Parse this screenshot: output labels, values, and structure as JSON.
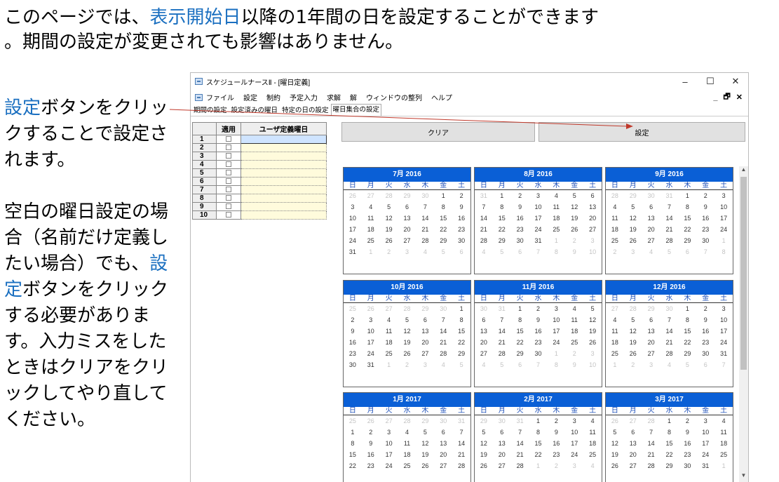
{
  "headline": {
    "part1": "このページでは、",
    "link": "表示開始日",
    "part2": "以降の1年間の日を設定することができます",
    "line2": "。期間の設定が変更されても影響はありません。"
  },
  "side": {
    "p1_link": "設定",
    "p1_text": "ボタンをクリックすることで設定されます。",
    "p2_text1": "空白の曜日設定の場合（名前だけ定義したい場合）でも、",
    "p2_link": "設定",
    "p2_text2": "ボタンをクリックする必要があります。入力ミスをしたときはクリアをクリックしてやり直してください。"
  },
  "window": {
    "title": "スケジュールナースⅡ - [曜日定義]",
    "min": "–",
    "max": "☐",
    "close": "✕",
    "mdi_min": "_",
    "mdi_restore": "🗗",
    "mdi_close": "✕"
  },
  "menu": [
    "ファイル",
    "設定",
    "制約",
    "予定入力",
    "求解",
    "解",
    "ウィンドウの整列",
    "ヘルプ"
  ],
  "tabs": [
    "期間の設定",
    "設定済みの曜日",
    "特定の日の設定",
    "曜日集合の設定"
  ],
  "grid": {
    "col_apply": "適用",
    "col_name": "ユーザ定義曜日",
    "rows": [
      "1",
      "2",
      "3",
      "4",
      "5",
      "6",
      "7",
      "8",
      "9",
      "10"
    ]
  },
  "buttons": {
    "clear": "クリア",
    "set": "設定"
  },
  "weekdays": [
    "日",
    "月",
    "火",
    "水",
    "木",
    "金",
    "土"
  ],
  "calendars": [
    {
      "title": "7月 2016",
      "days": [
        "26",
        "27",
        "28",
        "29",
        "30",
        "1",
        "2",
        "3",
        "4",
        "5",
        "6",
        "7",
        "8",
        "9",
        "10",
        "11",
        "12",
        "13",
        "14",
        "15",
        "16",
        "17",
        "18",
        "19",
        "20",
        "21",
        "22",
        "23",
        "24",
        "25",
        "26",
        "27",
        "28",
        "29",
        "30",
        "31",
        "1",
        "2",
        "3",
        "4",
        "5",
        "6"
      ],
      "lead": 5,
      "count": 31
    },
    {
      "title": "8月 2016",
      "days": [
        "31",
        "1",
        "2",
        "3",
        "4",
        "5",
        "6",
        "7",
        "8",
        "9",
        "10",
        "11",
        "12",
        "13",
        "14",
        "15",
        "16",
        "17",
        "18",
        "19",
        "20",
        "21",
        "22",
        "23",
        "24",
        "25",
        "26",
        "27",
        "28",
        "29",
        "30",
        "31",
        "1",
        "2",
        "3",
        "4",
        "5",
        "6",
        "7",
        "8",
        "9",
        "10"
      ],
      "lead": 1,
      "count": 31
    },
    {
      "title": "9月 2016",
      "days": [
        "28",
        "29",
        "30",
        "31",
        "1",
        "2",
        "3",
        "4",
        "5",
        "6",
        "7",
        "8",
        "9",
        "10",
        "11",
        "12",
        "13",
        "14",
        "15",
        "16",
        "17",
        "18",
        "19",
        "20",
        "21",
        "22",
        "23",
        "24",
        "25",
        "26",
        "27",
        "28",
        "29",
        "30",
        "1",
        "2",
        "3",
        "4",
        "5",
        "6",
        "7",
        "8"
      ],
      "lead": 4,
      "count": 30
    },
    {
      "title": "10月 2016",
      "days": [
        "25",
        "26",
        "27",
        "28",
        "29",
        "30",
        "1",
        "2",
        "3",
        "4",
        "5",
        "6",
        "7",
        "8",
        "9",
        "10",
        "11",
        "12",
        "13",
        "14",
        "15",
        "16",
        "17",
        "18",
        "19",
        "20",
        "21",
        "22",
        "23",
        "24",
        "25",
        "26",
        "27",
        "28",
        "29",
        "30",
        "31",
        "1",
        "2",
        "3",
        "4",
        "5"
      ],
      "lead": 6,
      "count": 31
    },
    {
      "title": "11月 2016",
      "days": [
        "30",
        "31",
        "1",
        "2",
        "3",
        "4",
        "5",
        "6",
        "7",
        "8",
        "9",
        "10",
        "11",
        "12",
        "13",
        "14",
        "15",
        "16",
        "17",
        "18",
        "19",
        "20",
        "21",
        "22",
        "23",
        "24",
        "25",
        "26",
        "27",
        "28",
        "29",
        "30",
        "1",
        "2",
        "3",
        "4",
        "5",
        "6",
        "7",
        "8",
        "9",
        "10"
      ],
      "lead": 2,
      "count": 30
    },
    {
      "title": "12月 2016",
      "days": [
        "27",
        "28",
        "29",
        "30",
        "1",
        "2",
        "3",
        "4",
        "5",
        "6",
        "7",
        "8",
        "9",
        "10",
        "11",
        "12",
        "13",
        "14",
        "15",
        "16",
        "17",
        "18",
        "19",
        "20",
        "21",
        "22",
        "23",
        "24",
        "25",
        "26",
        "27",
        "28",
        "29",
        "30",
        "31",
        "1",
        "2",
        "3",
        "4",
        "5",
        "6",
        "7"
      ],
      "lead": 4,
      "count": 31
    },
    {
      "title": "1月 2017",
      "days": [
        "25",
        "26",
        "27",
        "28",
        "29",
        "30",
        "31",
        "1",
        "2",
        "3",
        "4",
        "5",
        "6",
        "7",
        "8",
        "9",
        "10",
        "11",
        "12",
        "13",
        "14",
        "15",
        "16",
        "17",
        "18",
        "19",
        "20",
        "21",
        "22",
        "23",
        "24",
        "25",
        "26",
        "27",
        "28"
      ],
      "lead": 7,
      "count": 28
    },
    {
      "title": "2月 2017",
      "days": [
        "29",
        "30",
        "31",
        "1",
        "2",
        "3",
        "4",
        "5",
        "6",
        "7",
        "8",
        "9",
        "10",
        "11",
        "12",
        "13",
        "14",
        "15",
        "16",
        "17",
        "18",
        "19",
        "20",
        "21",
        "22",
        "23",
        "24",
        "25",
        "26",
        "27",
        "28",
        "1",
        "2",
        "3",
        "4"
      ],
      "lead": 3,
      "count": 28
    },
    {
      "title": "3月 2017",
      "days": [
        "26",
        "27",
        "28",
        "1",
        "2",
        "3",
        "4",
        "5",
        "6",
        "7",
        "8",
        "9",
        "10",
        "11",
        "12",
        "13",
        "14",
        "15",
        "16",
        "17",
        "18",
        "19",
        "20",
        "21",
        "22",
        "23",
        "24",
        "25",
        "26",
        "27",
        "28",
        "29",
        "30",
        "31",
        "1"
      ],
      "lead": 3,
      "count": 31
    }
  ],
  "colors": {
    "calendar_header": "#0a5fd6",
    "link": "#1a6fc0",
    "weekday": "#1d4fb8",
    "arrow": "#c0392b"
  }
}
